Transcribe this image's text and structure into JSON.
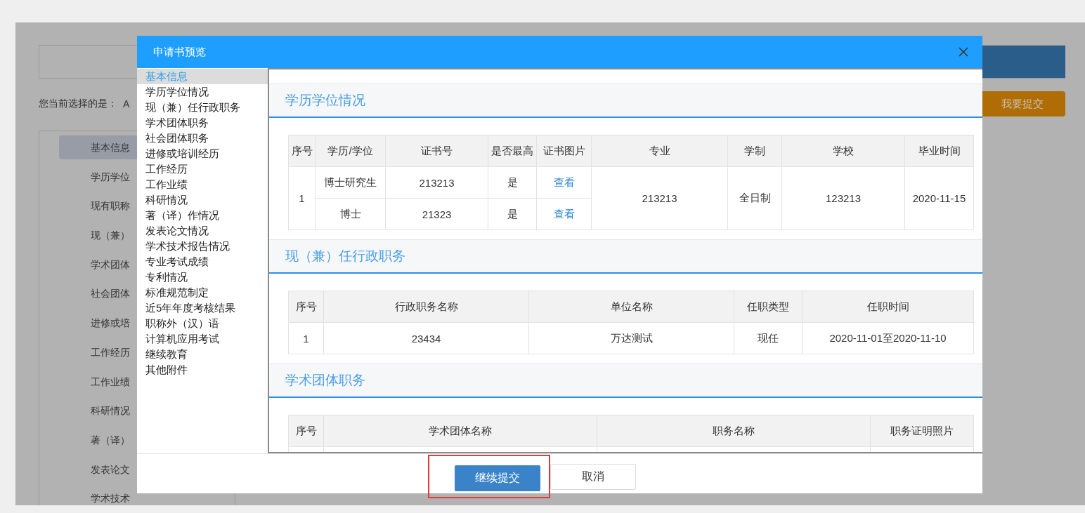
{
  "page": {
    "selection_label": "您当前选择的是：",
    "selection_value": "A",
    "submit_button": "我要提交",
    "sidebar": [
      {
        "label": "基本信息",
        "selected": true
      },
      {
        "label": "学历学位",
        "selected": false
      },
      {
        "label": "现有职称",
        "selected": false
      },
      {
        "label": "现（兼）",
        "selected": false
      },
      {
        "label": "学术团体",
        "selected": false
      },
      {
        "label": "社会团体",
        "selected": false
      },
      {
        "label": "进修或培",
        "selected": false
      },
      {
        "label": "工作经历",
        "selected": false
      },
      {
        "label": "工作业绩",
        "selected": false
      },
      {
        "label": "科研情况",
        "selected": false
      },
      {
        "label": "著（译）",
        "selected": false
      },
      {
        "label": "发表论文",
        "selected": false
      },
      {
        "label": "学术技术",
        "selected": false
      }
    ]
  },
  "dialog": {
    "title": "申请书预览",
    "nav": [
      {
        "label": "基本信息",
        "selected": true
      },
      {
        "label": "学历学位情况",
        "selected": false
      },
      {
        "label": "现（兼）任行政职务",
        "selected": false
      },
      {
        "label": "学术团体职务",
        "selected": false
      },
      {
        "label": "社会团体职务",
        "selected": false
      },
      {
        "label": "进修或培训经历",
        "selected": false
      },
      {
        "label": "工作经历",
        "selected": false
      },
      {
        "label": "工作业绩",
        "selected": false
      },
      {
        "label": "科研情况",
        "selected": false
      },
      {
        "label": "著（译）作情况",
        "selected": false
      },
      {
        "label": "发表论文情况",
        "selected": false
      },
      {
        "label": "学术技术报告情况",
        "selected": false
      },
      {
        "label": "专业考试成绩",
        "selected": false
      },
      {
        "label": "专利情况",
        "selected": false
      },
      {
        "label": "标准规范制定",
        "selected": false
      },
      {
        "label": "近5年年度考核结果",
        "selected": false
      },
      {
        "label": "职称外（汉）语",
        "selected": false
      },
      {
        "label": "计算机应用考试",
        "selected": false
      },
      {
        "label": "继续教育",
        "selected": false
      },
      {
        "label": "其他附件",
        "selected": false
      }
    ],
    "sections": [
      {
        "title": "学历学位情况",
        "columns": [
          "序号",
          "学历/学位",
          "证书号",
          "是否最高",
          "证书图片",
          "专业",
          "学制",
          "学校",
          "毕业时间"
        ],
        "rows": [
          [
            {
              "text": "1",
              "rowspan": 2
            },
            {
              "text": "博士研究生"
            },
            {
              "text": "213213"
            },
            {
              "text": "是"
            },
            {
              "text": "查看",
              "kind": "link"
            },
            {
              "text": "213213",
              "rowspan": 2
            },
            {
              "text": "全日制",
              "rowspan": 2
            },
            {
              "text": "123213",
              "rowspan": 2
            },
            {
              "text": "2020-11-15",
              "rowspan": 2
            }
          ],
          [
            {
              "text": "博士"
            },
            {
              "text": "21323"
            },
            {
              "text": "是"
            },
            {
              "text": "查看",
              "kind": "link"
            }
          ]
        ]
      },
      {
        "title": "现（兼）任行政职务",
        "columns": [
          "序号",
          "行政职务名称",
          "单位名称",
          "任职类型",
          "任职时间"
        ],
        "rows": [
          [
            {
              "text": "1"
            },
            {
              "text": "23434"
            },
            {
              "text": "万达测试"
            },
            {
              "text": "现任"
            },
            {
              "text": "2020-11-01至2020-11-10"
            }
          ]
        ]
      },
      {
        "title": "学术团体职务",
        "columns": [
          "序号",
          "学术团体名称",
          "职务名称",
          "职务证明照片"
        ]
      }
    ],
    "buttons": [
      {
        "label": "继续提交",
        "kind": "primary",
        "highlighted": true
      },
      {
        "label": "取消",
        "kind": "secondary",
        "highlighted": false
      }
    ]
  }
}
